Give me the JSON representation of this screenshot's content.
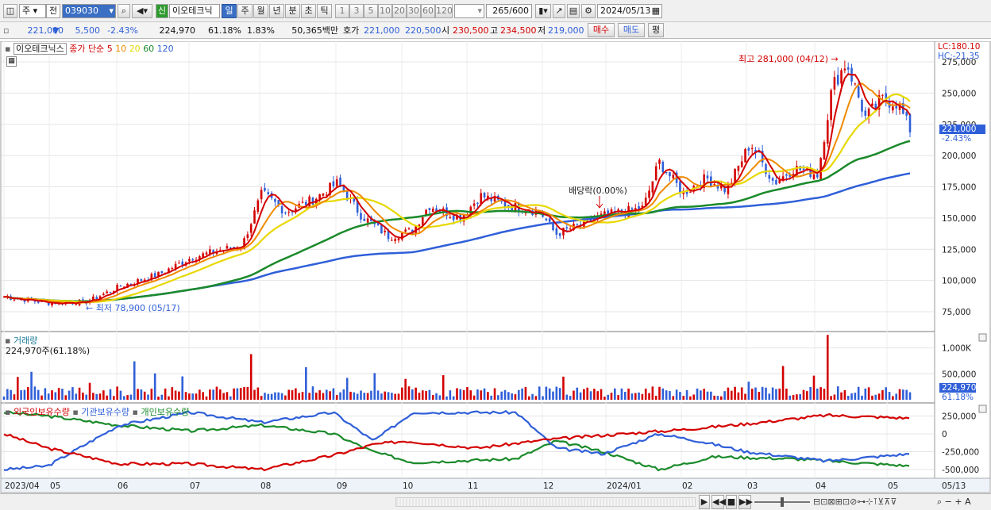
{
  "toolbar": {
    "period_type": "주",
    "mode": "전",
    "stock_code": "039030",
    "sin_label": "신",
    "stock_name": "이오테크닉",
    "tabs": [
      "일",
      "주",
      "월",
      "년",
      "분",
      "초",
      "틱"
    ],
    "selected_tab": "일",
    "intervals": [
      "1",
      "3",
      "5",
      "10",
      "20",
      "30",
      "60",
      "120"
    ],
    "count": "265",
    "count_max": "/600",
    "date": "2024/05/13"
  },
  "quote": {
    "price": "221,000",
    "change": "5,500",
    "change_pct": "-2.43%",
    "volume": "224,970",
    "vol_ratio": "61.18%",
    "turnover": "1.83%",
    "amount": "50,365백만",
    "ask_label": "호가",
    "ask1": "221,000",
    "ask2": "220,500",
    "open_label": "시",
    "open": "230,500",
    "high_label": "고",
    "high": "234,500",
    "low_label": "저",
    "low": "219,000",
    "buy": "매수",
    "sell": "매도",
    "eval": "평"
  },
  "price_panel": {
    "name_label": "이오테크닉스",
    "close_label": "종가 단순",
    "ma_labels": [
      {
        "text": "5",
        "color": "#d40000"
      },
      {
        "text": "10",
        "color": "#f08a00"
      },
      {
        "text": "20",
        "color": "#e8d800"
      },
      {
        "text": "60",
        "color": "#1a8a2a"
      },
      {
        "text": "120",
        "color": "#2f5fd8"
      }
    ],
    "lc": "LC:180.10",
    "hc": "HC:-21.35",
    "current_price": "221,000",
    "current_pct": "-2.43%",
    "high_note": "최고 281,000 (04/12)",
    "low_note": "최저 78,900 (05/17)",
    "div_note": "배당락(0.00%)",
    "y_ticks": [
      "275,000",
      "250,000",
      "225,000",
      "200,000",
      "175,000",
      "150,000",
      "125,000",
      "100,000",
      "75,000"
    ]
  },
  "volume_panel": {
    "title": "거래량",
    "value": "224,970주(61.18%)",
    "y_ticks": [
      "1,000K",
      "500,000"
    ],
    "current": "224,970",
    "current_pct": "61.18%"
  },
  "holding_panel": {
    "series": [
      {
        "name": "외국인보유수량",
        "color": "#d40000"
      },
      {
        "name": "기관보유수량",
        "color": "#2f5fd8"
      },
      {
        "name": "개인보유수량",
        "color": "#1a8a2a"
      }
    ],
    "y_ticks": [
      "250,000",
      "0",
      "-250,000",
      "-500,000"
    ]
  },
  "x_axis": {
    "labels": [
      "2023/04",
      "05",
      "06",
      "07",
      "08",
      "09",
      "10",
      "11",
      "12",
      "2024/01",
      "02",
      "03",
      "04",
      "05"
    ],
    "right_label": "05/13"
  },
  "colors": {
    "up": "#d40000",
    "down": "#2f5fd8",
    "ma5": "#d40000",
    "ma10": "#f08a00",
    "ma20": "#e8d800",
    "ma60": "#1a8a2a",
    "ma120": "#2f5fd8"
  }
}
